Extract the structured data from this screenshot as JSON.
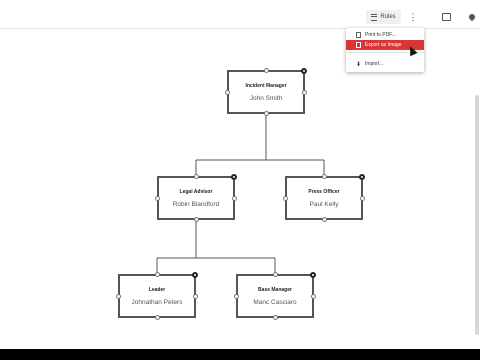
{
  "toolbar": {
    "rules_label": "Rules",
    "more_icon": "more-vertical-icon",
    "comment_icon": "comment-icon",
    "location_icon": "map-pin-icon"
  },
  "menu": {
    "items": [
      {
        "label": "Print to PDF...",
        "icon": "pdf-icon"
      },
      {
        "label": "Export as Image",
        "icon": "image-icon"
      },
      {
        "label": "Import...",
        "icon": "download-icon"
      }
    ],
    "accent": "#d93535"
  },
  "org": {
    "incident_manager": {
      "role": "Incident Manager",
      "name": "John Smith"
    },
    "legal_advisor": {
      "role": "Legal Advisor",
      "name": "Robin Blandford"
    },
    "press_officer": {
      "role": "Press Officer",
      "name": "Paul Kelly"
    },
    "leader": {
      "role": "Leader",
      "name": "Johnathan Peters"
    },
    "base_manager": {
      "role": "Base Manager",
      "name": "Manc Casciaro"
    }
  }
}
